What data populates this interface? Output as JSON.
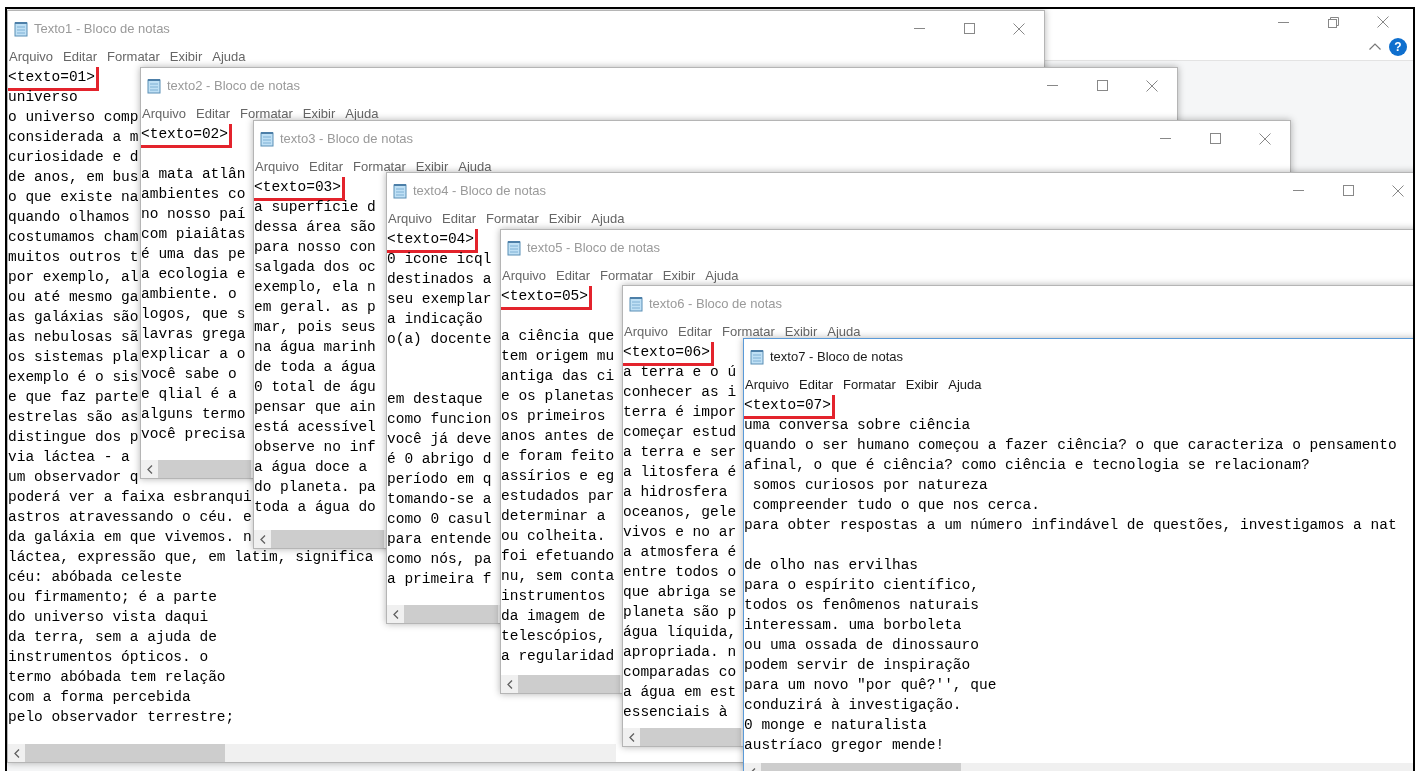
{
  "background_window": {
    "help_button": "?"
  },
  "windows": [
    {
      "title": "Texto1 - Bloco de notas",
      "active": false,
      "menu": [
        "Arquivo",
        "Editar",
        "Formatar",
        "Exibir",
        "Ajuda"
      ],
      "marker": "<texto=01>",
      "blocks": [
        [
          "universo",
          "o universo comp",
          "considerada a m",
          "curiosidade e d",
          "de anos, em bus",
          "o que existe na",
          "quando olhamos",
          "costumamos cham",
          "muitos outros t",
          "por exemplo, al",
          "ou até mesmo ga",
          "as galáxias são",
          "as nebulosas sã",
          "os sistemas pla",
          "exemplo é o sis",
          "e que faz parte",
          "estrelas são as",
          "distingue dos p",
          "via láctea - a",
          "um observador q",
          "poderá ver a faixa esbranqui",
          "astros atravessando o céu. e",
          "da galáxia em que vivemos. n",
          "láctea, expressão que, em latim, significa",
          "céu: abóbada celeste",
          "ou firmamento; é a parte",
          "do universo vista daqui",
          "da terra, sem a ajuda de",
          "instrumentos ópticos. o",
          "termo abóbada tem relação",
          "com a forma percebida",
          "pelo observador terrestre;"
        ]
      ]
    },
    {
      "title": "texto2 - Bloco de notas",
      "active": false,
      "menu": [
        "Arquivo",
        "Editar",
        "Formatar",
        "Exibir",
        "Ajuda"
      ],
      "marker": "<texto=02>",
      "blocks": [
        [
          "a mata atlân",
          "ambientes co",
          "no nosso paí",
          "com piaiâtas",
          "é uma das pe",
          "a ecologia e",
          "ambiente. o",
          "logos, que s",
          "lavras grega",
          "explicar a o",
          "você sabe o",
          "e qlial é a",
          "alguns termo",
          "você precisa"
        ]
      ]
    },
    {
      "title": "texto3 - Bloco de notas",
      "active": false,
      "menu": [
        "Arquivo",
        "Editar",
        "Formatar",
        "Exibir",
        "Ajuda"
      ],
      "marker": "<texto=03>",
      "blocks": [
        [
          "a superfície d",
          "dessa área são",
          "para nosso con",
          "salgada dos oc",
          "exemplo, ela n",
          "em geral. as p",
          "mar, pois seus",
          "na água marinh",
          "de toda a água",
          "0 total de águ",
          "pensar que ain",
          "está acessível",
          "observe no inf",
          "a água doce a",
          "do planeta. pa",
          "toda a água do"
        ]
      ]
    },
    {
      "title": "texto4 - Bloco de notas",
      "active": false,
      "menu": [
        "Arquivo",
        "Editar",
        "Formatar",
        "Exibir",
        "Ajuda"
      ],
      "marker": "<texto=04>",
      "blocks": [
        [
          "0 icone icql",
          "destinados a",
          "seu exemplar",
          "a indicação",
          "o(a) docente"
        ],
        [
          "em destaque",
          "como funcion",
          "você já deve",
          "é 0 abrigo d",
          "período em q",
          "tomando-se a",
          "como 0 casul",
          "para entende",
          "como nós, pa",
          "a primeira f"
        ]
      ]
    },
    {
      "title": "texto5 - Bloco de notas",
      "active": false,
      "menu": [
        "Arquivo",
        "Editar",
        "Formatar",
        "Exibir",
        "Ajuda"
      ],
      "marker": "<texto=05>",
      "blocks": [
        [
          "a ciência que",
          "tem origem mu",
          "antiga das ci",
          "e os planetas",
          "os primeiros",
          "anos antes de",
          "e foram feito",
          "assírios e eg",
          "estudados par",
          "determinar a",
          "ou colheita.",
          "foi efetuando",
          "nu, sem conta",
          "instrumentos",
          "da imagem de",
          "telescópios,",
          "a regularidad"
        ]
      ]
    },
    {
      "title": "texto6 - Bloco de notas",
      "active": false,
      "menu": [
        "Arquivo",
        "Editar",
        "Formatar",
        "Exibir",
        "Ajuda"
      ],
      "marker": "<texto=06>",
      "blocks": [
        [
          "a terra e o ú",
          "conhecer as i",
          "terra é impor",
          "começar estud",
          "a terra e ser",
          "a litosfera é",
          "a hidrosfera",
          "oceanos, gele",
          "vivos e no ar",
          "a atmosfera é",
          "entre todos o",
          "que abriga se",
          "planeta são p",
          "água líquida,",
          "apropriada. n",
          "comparadas co",
          "a água em est",
          "essenciais à"
        ]
      ]
    },
    {
      "title": "texto7 - Bloco de notas",
      "active": true,
      "menu": [
        "Arquivo",
        "Editar",
        "Formatar",
        "Exibir",
        "Ajuda"
      ],
      "marker": "<texto=07>",
      "blocks": [
        [
          "uma conversa sobre ciência",
          "quando o ser humano começou a fazer ciência? o que caracteriza o pensamento",
          "afinal, o que é ciência? como ciência e tecnologia se relacionam?",
          " somos curiosos por natureza",
          " compreender tudo o que nos cerca.",
          "para obter respostas a um número infindável de questões, investigamos a nat"
        ],
        [
          "de olho nas ervilhas",
          "para o espírito científico,",
          "todos os fenômenos naturais",
          "interessam. uma borboleta",
          "ou uma ossada de dinossauro",
          "podem servir de inspiração",
          "para um novo \"por quê?'', que",
          "conduzirá à investigação.",
          "0 monge e naturalista",
          "austríaco gregor mende!"
        ]
      ]
    }
  ]
}
